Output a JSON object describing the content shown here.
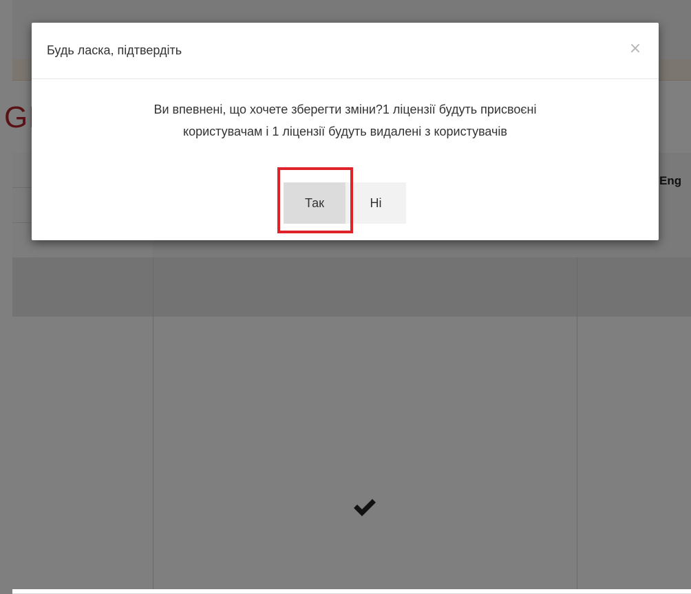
{
  "background": {
    "page_title_fragment": "GI",
    "column_header_fragment": "Eng"
  },
  "modal": {
    "title": "Будь ласка, підтвердіть",
    "close_symbol": "×",
    "message_line1": "Ви впевнені, що хочете зберегти зміни?1 ліцензії будуть присвоєні",
    "message_line2": "користувачам і 1 ліцензії будуть видалені з користувачів",
    "yes_label": "Так",
    "no_label": "Ні"
  },
  "colors": {
    "highlight": "#e0222b",
    "title_red": "#b3262e"
  }
}
